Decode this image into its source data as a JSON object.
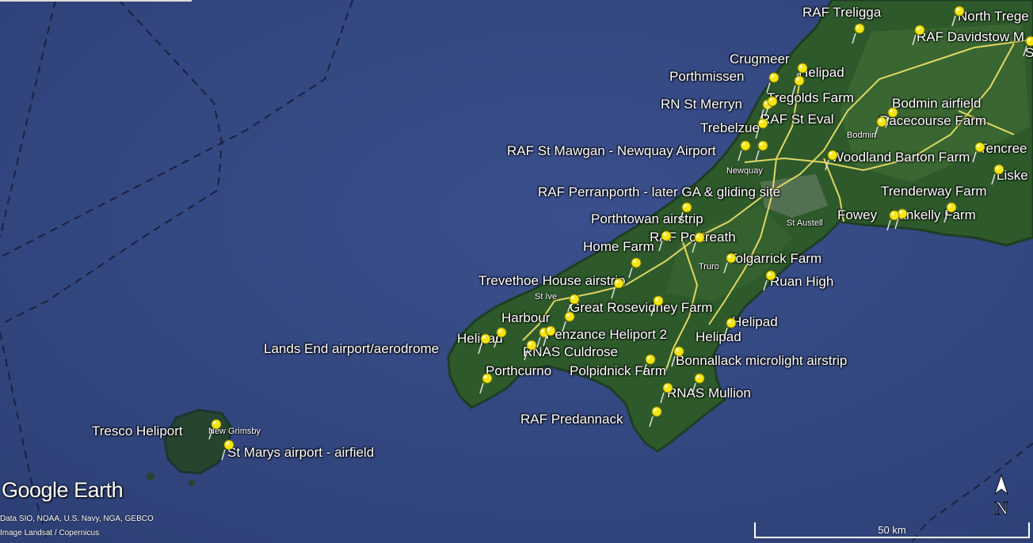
{
  "map": {
    "brand": "Google Earth",
    "credits": [
      "Data SIO, NOAA, U.S. Navy, NGA, GEBCO",
      "Image Landsat / Copernicus"
    ],
    "scale_label": "50 km",
    "compass_label": "N",
    "colors": {
      "sea": "#33467f",
      "land": "#2d5a2a",
      "pin": "#f4e614",
      "road": "#f2e46a"
    }
  },
  "places": [
    {
      "id": "raf-treligga",
      "label": "RAF Treligga"
    },
    {
      "id": "north-treg",
      "label": "North Trege"
    },
    {
      "id": "raf-davidstow",
      "label": "RAF Davidstow M"
    },
    {
      "id": "s",
      "label": "S"
    },
    {
      "id": "crugmeer",
      "label": "Crugmeer"
    },
    {
      "id": "porthmissen",
      "label": "Porthmissen"
    },
    {
      "id": "helipad-1",
      "label": "Helipad"
    },
    {
      "id": "rn-st-merryn",
      "label": "RN St Merryn"
    },
    {
      "id": "tregolds-farm",
      "label": "Tregolds Farm"
    },
    {
      "id": "bodmin-airfield",
      "label": "Bodmin airfield"
    },
    {
      "id": "raf-st-eval",
      "label": "RAF St Eval"
    },
    {
      "id": "racecourse-farm",
      "label": "Racecourse Farm"
    },
    {
      "id": "trebelzue",
      "label": "Trebelzue"
    },
    {
      "id": "tencree",
      "label": "Tencree"
    },
    {
      "id": "raf-st-mawgan",
      "label": "RAF St Mawgan - Newquay Airport"
    },
    {
      "id": "woodland-barton",
      "label": "Woodland Barton Farm"
    },
    {
      "id": "liske",
      "label": "Liske"
    },
    {
      "id": "raf-perranporth",
      "label": "RAF Perranporth - later GA & gliding site"
    },
    {
      "id": "trenderway-farm",
      "label": "Trenderway Farm"
    },
    {
      "id": "fowey",
      "label": "Fowey"
    },
    {
      "id": "lankelly-farm",
      "label": "Lankelly Farm"
    },
    {
      "id": "porthtowan",
      "label": "Porthtowan airstrip"
    },
    {
      "id": "raf-portreath",
      "label": "RAF Portreath"
    },
    {
      "id": "home-farm",
      "label": "Home Farm"
    },
    {
      "id": "tolgarrick-farm",
      "label": "Tolgarrick Farm"
    },
    {
      "id": "ruan-high",
      "label": "Ruan High"
    },
    {
      "id": "trevethoe",
      "label": "Trevethoe House airstrip"
    },
    {
      "id": "great-rosevidney",
      "label": "Great Rosevidney Farm"
    },
    {
      "id": "harbour",
      "label": "Harbour"
    },
    {
      "id": "helipad-2",
      "label": "Helipad"
    },
    {
      "id": "penzance-heliport",
      "label": "Penzance Heliport 2"
    },
    {
      "id": "helipad-3",
      "label": "Helipad"
    },
    {
      "id": "lands-end",
      "label": "Lands End airport/aerodrome"
    },
    {
      "id": "helipad-4",
      "label": "Helipad"
    },
    {
      "id": "rnas-culdrose",
      "label": "RNAS Culdrose"
    },
    {
      "id": "bonnallack",
      "label": "Bonnallack microlight airstrip"
    },
    {
      "id": "porthcurno",
      "label": "Porthcurno"
    },
    {
      "id": "polpidnick",
      "label": "Polpidnick Farm"
    },
    {
      "id": "rnas-mullion",
      "label": "RNAS Mullion"
    },
    {
      "id": "raf-predannack",
      "label": "RAF Predannack"
    },
    {
      "id": "tresco",
      "label": "Tresco Heliport"
    },
    {
      "id": "st-marys",
      "label": "St Marys airport - airfield"
    }
  ],
  "towns": [
    {
      "id": "bodmin",
      "label": "Bodmin"
    },
    {
      "id": "newquay",
      "label": "Newquay"
    },
    {
      "id": "st-austell",
      "label": "St Austell"
    },
    {
      "id": "truro",
      "label": "Truro"
    },
    {
      "id": "st-ives",
      "label": "St Ive"
    },
    {
      "id": "new-grimsby",
      "label": "New Grimsby"
    }
  ]
}
